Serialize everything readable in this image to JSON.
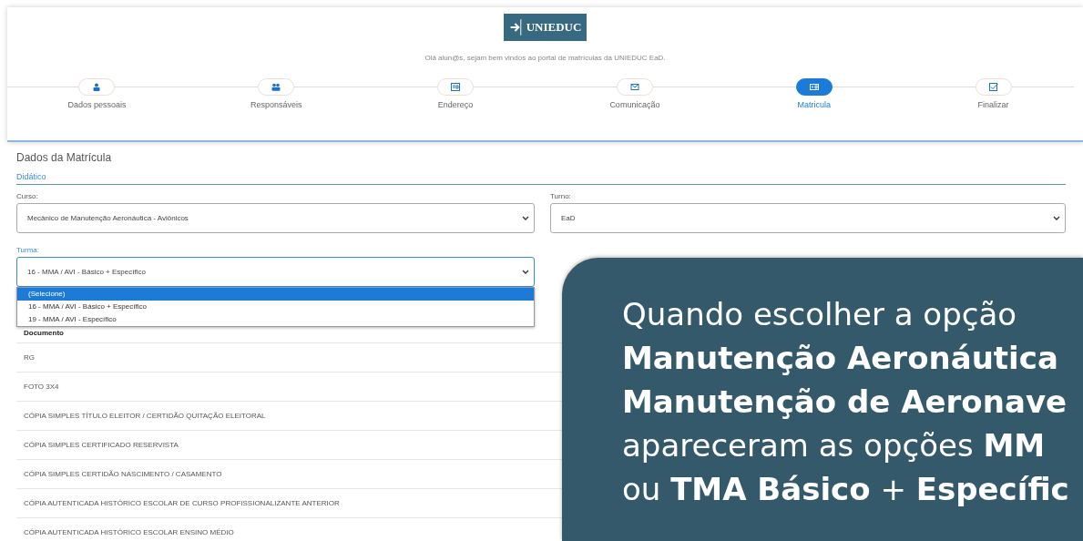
{
  "header": {
    "logo": "UNIEDUC",
    "welcome": "Olá alun@s, sejam bem vindos ao portal de matrículas da UNIEDUC EaD."
  },
  "steps": [
    {
      "label": "Dados pessoais",
      "selected": false
    },
    {
      "label": "Responsáveis",
      "selected": false
    },
    {
      "label": "Endereço",
      "selected": false
    },
    {
      "label": "Comunicação",
      "selected": false
    },
    {
      "label": "Matricula",
      "selected": true
    },
    {
      "label": "Finalizar",
      "selected": false
    }
  ],
  "section": {
    "title": "Dados da Matrícula",
    "subtitle": "Didático"
  },
  "fields": {
    "curso": {
      "label": "Curso:",
      "value": "Mecânico de Manutenção Aeronáutica - Aviônicos"
    },
    "turno": {
      "label": "Turno:",
      "value": "EaD"
    },
    "turma": {
      "label": "Turma:",
      "value": "16 - MMA / AVI - Básico + Específico"
    }
  },
  "turma_options": [
    {
      "label": "(Selecione)",
      "selected": true
    },
    {
      "label": "16 - MMA / AVI - Básico + Específico",
      "selected": false
    },
    {
      "label": "19 - MMA / AVI - Específico",
      "selected": false
    }
  ],
  "table": {
    "columns": [
      "Documento"
    ],
    "rows": [
      "RG",
      "FOTO 3X4",
      "CÓPIA SIMPLES TÍTULO ELEITOR / CERTIDÃO QUITAÇÃO ELEITORAL",
      "CÓPIA SIMPLES CERTIFICADO RESERVISTA",
      "CÓPIA SIMPLES CERTIDÃO NASCIMENTO / CASAMENTO",
      "CÓPIA AUTENTICADA HISTÓRICO ESCOLAR DE CURSO PROFISSIONALIZANTE ANTERIOR",
      "CÓPIA AUTENTICADA HISTÓRICO ESCOLAR ENSINO MÉDIO"
    ]
  },
  "callout": {
    "lines": [
      "Quando escolher a opção",
      "**Manutenção Aeronáutica**",
      "**Manutenção de Aeronave**",
      "apareceram as opções **MM**",
      "ou **TMA Básico** + **Específic**"
    ]
  }
}
